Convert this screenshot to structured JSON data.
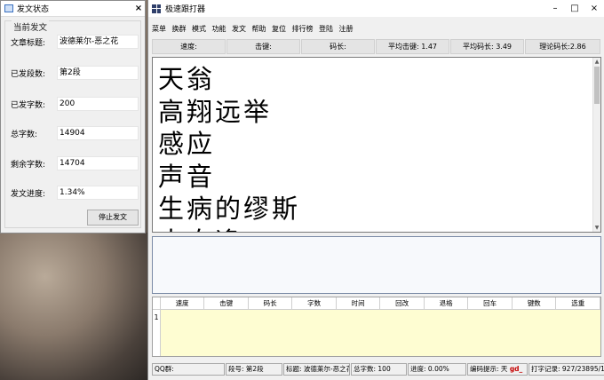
{
  "left_window": {
    "title": "发文状态",
    "close": "×",
    "group_label": "当前发文",
    "rows": [
      {
        "label": "文章标题:",
        "value": "波德莱尔-恶之花"
      },
      {
        "label": "已发段数:",
        "value": "第2段"
      },
      {
        "label": "已发字数:",
        "value": "200"
      },
      {
        "label": "总字数:",
        "value": "14904"
      },
      {
        "label": "剩余字数:",
        "value": "14704"
      },
      {
        "label": "发文进度:",
        "value": "1.34%"
      }
    ],
    "stop_button": "停止发文"
  },
  "main_window": {
    "title": "极速跟打器",
    "controls": {
      "minimize": "–",
      "maximize": "□",
      "close": "×"
    },
    "menu": [
      "菜单",
      "换群",
      "模式",
      "功能",
      "发文",
      "帮助",
      "复位",
      "排行榜",
      "登陆",
      "注册"
    ],
    "stats": [
      "速度:",
      "击键:",
      "码长:",
      "平均击键: 1.47",
      "平均码长: 3.49",
      "理论码长:2.86"
    ],
    "text_lines": [
      "天翁",
      "高翔远举",
      "感应",
      "声音",
      "生病的缪斯",
      "大自逢"
    ],
    "grid_headers": [
      "速度",
      "击键",
      "码长",
      "字数",
      "时间",
      "回改",
      "退格",
      "回车",
      "键数",
      "选重"
    ],
    "grid_row_number": "1",
    "status": {
      "qq_group": "QQ群:",
      "segment": "段号: 第2段",
      "title": "标题: 波德莱尔-恶之花",
      "total": "总字数: 100",
      "progress": "进度: 0.00%",
      "hint_label": "编码提示: 天",
      "hint_code": "gd_",
      "record": "打字记录: 927/23895/15天"
    }
  },
  "colors": {
    "grid_row_bg": "#fefdd2",
    "hint_code": "#c40000"
  }
}
